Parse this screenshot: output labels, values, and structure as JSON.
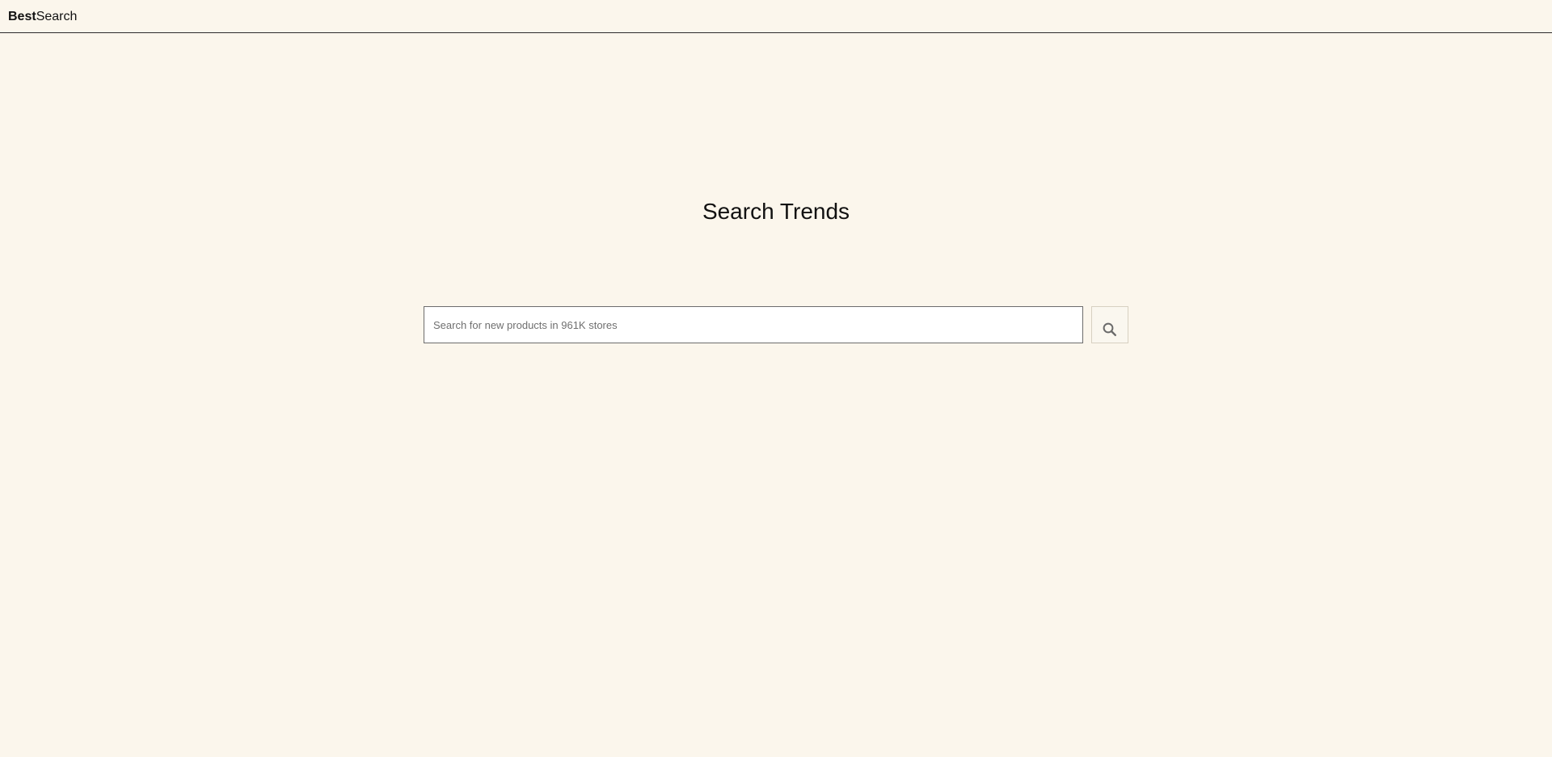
{
  "app": {
    "logo": {
      "strong": "Best",
      "light": "Search"
    }
  },
  "main": {
    "title": "Search Trends",
    "search": {
      "value": "",
      "placeholder": "Search for new products in 961K stores",
      "button_icon": "search-icon"
    }
  },
  "theme": {
    "background": "#fbf6ec",
    "text": "#111111",
    "divider": "#2b2b2b",
    "input_border": "#6c6c6c",
    "button_border": "#d7d0c1",
    "icon": "#6a6a6a"
  }
}
